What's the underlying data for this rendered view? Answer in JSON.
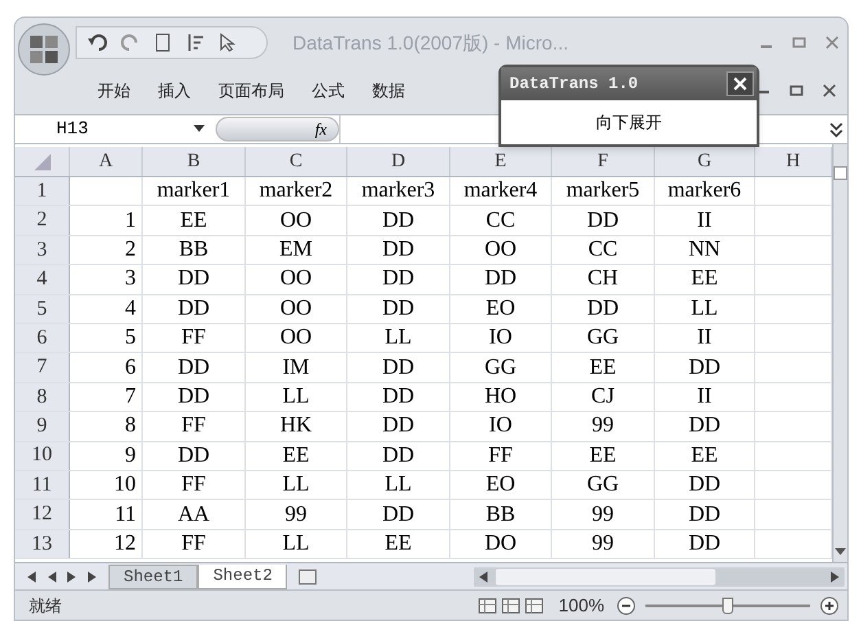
{
  "window": {
    "title": "DataTrans 1.0(2007版) - Micro..."
  },
  "ribbon_tabs": [
    {
      "label": "开始"
    },
    {
      "label": "插入"
    },
    {
      "label": "页面布局"
    },
    {
      "label": "公式"
    },
    {
      "label": "数据"
    }
  ],
  "formula_bar": {
    "name_box": "H13",
    "fx": "fx"
  },
  "popup": {
    "title": "DataTrans 1.0",
    "button": "向下展开"
  },
  "columns": [
    "A",
    "B",
    "C",
    "D",
    "E",
    "F",
    "G",
    "H"
  ],
  "rows": [
    {
      "num": "1",
      "cells": [
        null,
        "marker1",
        "marker2",
        "marker3",
        "marker4",
        "marker5",
        "marker6",
        null
      ]
    },
    {
      "num": "2",
      "cells": [
        "1",
        "EE",
        "OO",
        "DD",
        "CC",
        "DD",
        "II",
        null
      ]
    },
    {
      "num": "3",
      "cells": [
        "2",
        "BB",
        "EM",
        "DD",
        "OO",
        "CC",
        "NN",
        null
      ]
    },
    {
      "num": "4",
      "cells": [
        "3",
        "DD",
        "OO",
        "DD",
        "DD",
        "CH",
        "EE",
        null
      ]
    },
    {
      "num": "5",
      "cells": [
        "4",
        "DD",
        "OO",
        "DD",
        "EO",
        "DD",
        "LL",
        null
      ]
    },
    {
      "num": "6",
      "cells": [
        "5",
        "FF",
        "OO",
        "LL",
        "IO",
        "GG",
        "II",
        null
      ]
    },
    {
      "num": "7",
      "cells": [
        "6",
        "DD",
        "IM",
        "DD",
        "GG",
        "EE",
        "DD",
        null
      ]
    },
    {
      "num": "8",
      "cells": [
        "7",
        "DD",
        "LL",
        "DD",
        "HO",
        "CJ",
        "II",
        null
      ]
    },
    {
      "num": "9",
      "cells": [
        "8",
        "FF",
        "HK",
        "DD",
        "IO",
        "99",
        "DD",
        null
      ]
    },
    {
      "num": "10",
      "cells": [
        "9",
        "DD",
        "EE",
        "DD",
        "FF",
        "EE",
        "EE",
        null
      ]
    },
    {
      "num": "11",
      "cells": [
        "10",
        "FF",
        "LL",
        "LL",
        "EO",
        "GG",
        "DD",
        null
      ]
    },
    {
      "num": "12",
      "cells": [
        "11",
        "AA",
        "99",
        "DD",
        "BB",
        "99",
        "DD",
        null
      ]
    },
    {
      "num": "13",
      "cells": [
        "12",
        "FF",
        "LL",
        "EE",
        "DO",
        "99",
        "DD",
        null
      ]
    }
  ],
  "sheet_tabs": [
    {
      "label": "Sheet1",
      "selected": false
    },
    {
      "label": "Sheet2",
      "selected": true
    }
  ],
  "status_bar": {
    "status": "就绪",
    "zoom": "100%",
    "zoom_slider": {
      "level": 0.5
    }
  }
}
